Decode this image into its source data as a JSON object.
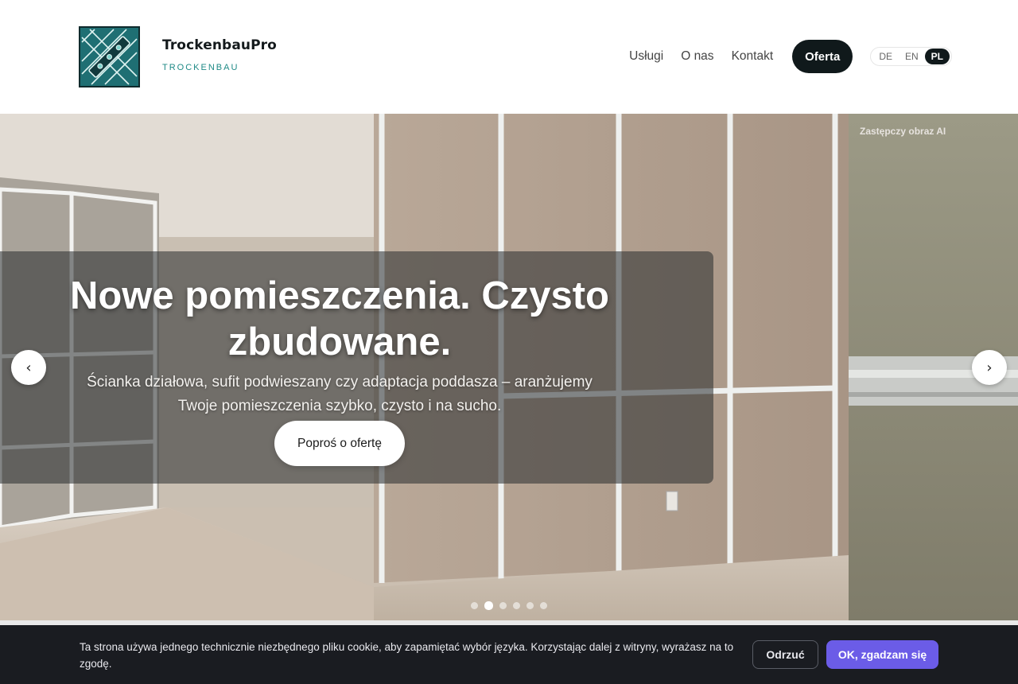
{
  "brand": {
    "name": "TrockenbauPro",
    "subtitle": "TROCKENBAU",
    "logo_icon": "level-tool-logo-icon"
  },
  "nav": {
    "links": [
      "Usługi",
      "O nas",
      "Kontakt"
    ],
    "cta": "Oferta",
    "languages": [
      "DE",
      "EN",
      "PL"
    ],
    "active_language": "PL"
  },
  "hero": {
    "badge": "Zastępczy obraz AI",
    "headline": "Nowe pomieszczenia. Czysto zbudowane.",
    "subline": "Ścianka działowa, sufit podwieszany czy adaptacja poddasza – aranżujemy Twoje pomieszczenia szybko, czysto i na sucho.",
    "cta": "Poproś o ofertę",
    "prev_icon": "chevron-left-icon",
    "next_icon": "chevron-right-icon",
    "prev_symbol": "‹",
    "next_symbol": "›",
    "slide_count": 6,
    "active_slide": 2
  },
  "cookie": {
    "text": "Ta strona używa jednego technicznie niezbędnego pliku cookie, aby zapamiętać wybór języka. Korzystając dalej z witryny, wyrażasz na to zgodę.",
    "decline": "Odrzuć",
    "accept": "OK, zgadzam się"
  },
  "colors": {
    "brand_teal": "#1f8a86",
    "dark": "#10191b",
    "accent_purple": "#6b5ce7",
    "cookie_bg": "#1a1c21"
  }
}
